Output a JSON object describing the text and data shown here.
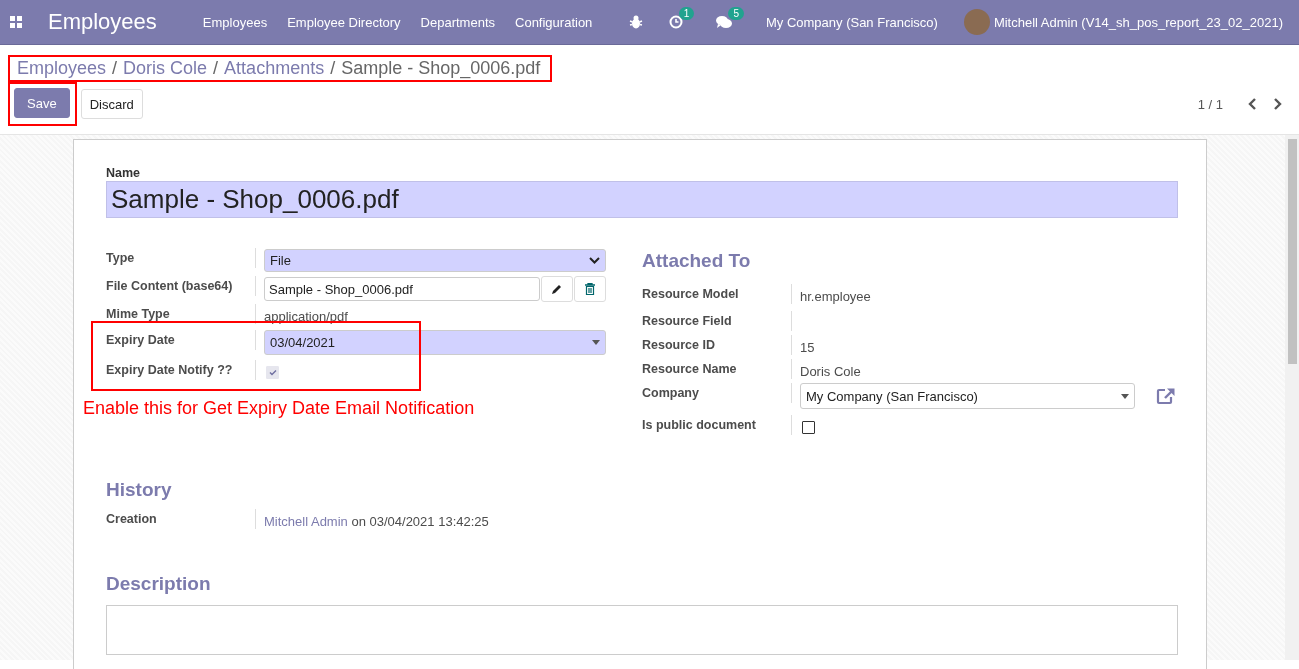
{
  "navbar": {
    "app_name": "Employees",
    "menu": [
      "Employees",
      "Employee Directory",
      "Departments",
      "Configuration"
    ],
    "activity_count": "1",
    "message_count": "5",
    "company": "My Company (San Francisco)",
    "user": "Mitchell Admin (V14_sh_pos_report_23_02_2021)"
  },
  "breadcrumb": {
    "highlighted": true,
    "links": [
      {
        "label": "Employees",
        "separator": "/"
      },
      {
        "label": "Doris Cole",
        "separator": "/"
      },
      {
        "label": "Attachments",
        "separator": "/"
      }
    ],
    "current": "Sample - Shop_0006.pdf"
  },
  "buttons": [
    {
      "label": "Save",
      "kind": "primary",
      "highlighted": true
    },
    {
      "label": "Discard",
      "kind": "secondary",
      "highlighted": false
    }
  ],
  "pager": "1 / 1",
  "form": {
    "name_label": "Name",
    "name_value": "Sample - Shop_0006.pdf",
    "fields": [
      {
        "label": "Type",
        "kind": "select",
        "value": "File",
        "highlighted": false
      },
      {
        "label": "File Content (base64)",
        "kind": "binary",
        "value": "Sample - Shop_0006.pdf",
        "highlighted": false
      },
      {
        "label": "Mime Type",
        "kind": "text",
        "value": "application/pdf",
        "highlighted": false
      },
      {
        "label": "Expiry Date",
        "kind": "date",
        "value": "03/04/2021",
        "highlighted": true
      },
      {
        "label": "Expiry Date Notify ??",
        "kind": "checkbox",
        "checked": true,
        "highlighted": true
      }
    ],
    "note": "Enable this for Get Expiry Date Email Notification",
    "attached_to": {
      "title": "Attached To",
      "fields": [
        {
          "label": "Resource Model",
          "kind": "text",
          "value": "hr.employee"
        },
        {
          "label": "Resource Field",
          "kind": "text"
        },
        {
          "label": "Resource ID",
          "kind": "text",
          "value": "15"
        },
        {
          "label": "Resource Name",
          "kind": "text",
          "value": "Doris Cole"
        },
        {
          "label": "Company",
          "kind": "many2one",
          "value": "My Company (San Francisco)"
        },
        {
          "label": "Is public document",
          "kind": "checkbox",
          "checked": false
        }
      ]
    },
    "history": {
      "title": "History",
      "label": "Creation",
      "author": "Mitchell Admin",
      "text": "on 03/04/2021 13:42:25"
    },
    "description": {
      "title": "Description"
    }
  }
}
